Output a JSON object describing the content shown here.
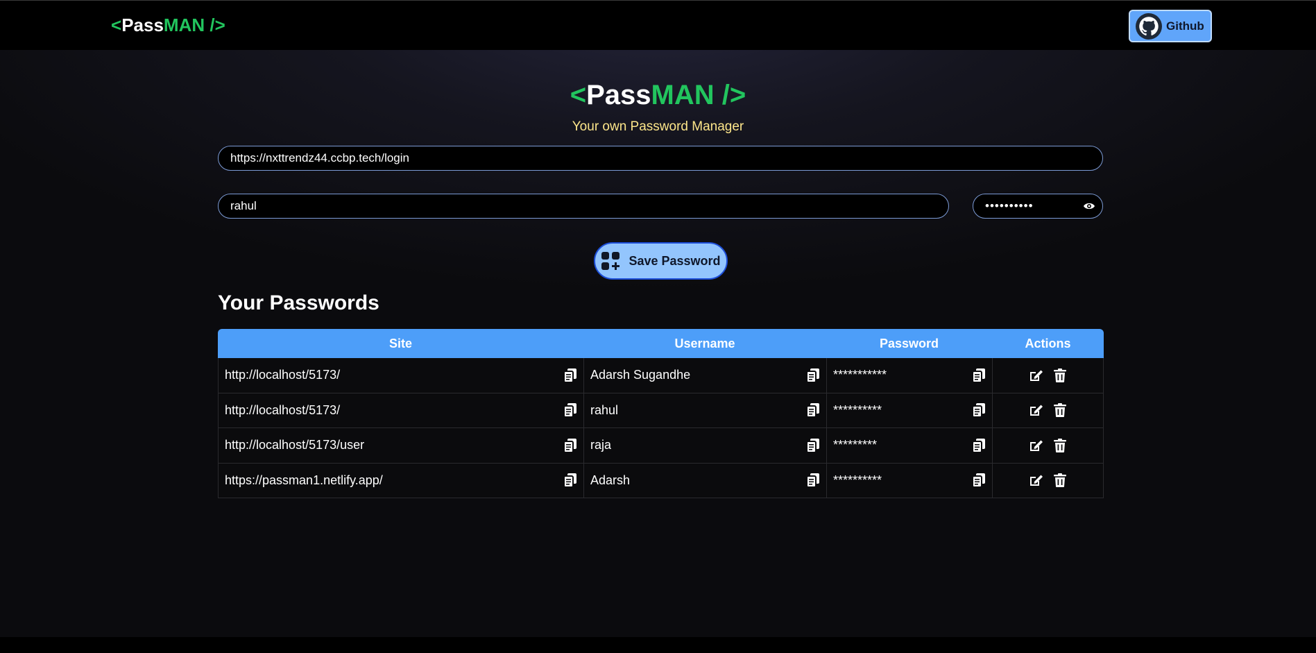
{
  "nav": {
    "logo": {
      "open": "<",
      "pass": "Pass",
      "man": "MAN",
      "close": " />"
    },
    "github_label": "Github",
    "github_icon": "github-icon"
  },
  "hero": {
    "logo": {
      "open": "<",
      "pass": "Pass",
      "man": "MAN",
      "close": " />"
    },
    "tagline": "Your own Password Manager"
  },
  "form": {
    "site_value": "https://nxttrendz44.ccbp.tech/login",
    "username_value": "rahul",
    "password_value": "••••••••••",
    "show_password_icon": "eye-icon",
    "save_label": "Save Password",
    "save_icon": "add-grid-icon"
  },
  "passwords": {
    "title": "Your Passwords",
    "columns": [
      "Site",
      "Username",
      "Password",
      "Actions"
    ],
    "rows": [
      {
        "site": "http://localhost/5173/",
        "username": "Adarsh Sugandhe",
        "password": "***********"
      },
      {
        "site": "http://localhost/5173/",
        "username": "rahul",
        "password": "**********"
      },
      {
        "site": "http://localhost/5173/user",
        "username": "raja",
        "password": "*********"
      },
      {
        "site": "https://passman1.netlify.app/",
        "username": "Adarsh",
        "password": "**********"
      }
    ],
    "row_icons": [
      "copy-icon",
      "edit-icon",
      "trash-icon"
    ]
  },
  "colors": {
    "accent_green": "#22c55e",
    "header_blue": "#4d9ef9",
    "button_blue": "#93c5fd",
    "tagline_yellow": "#fde68a"
  }
}
